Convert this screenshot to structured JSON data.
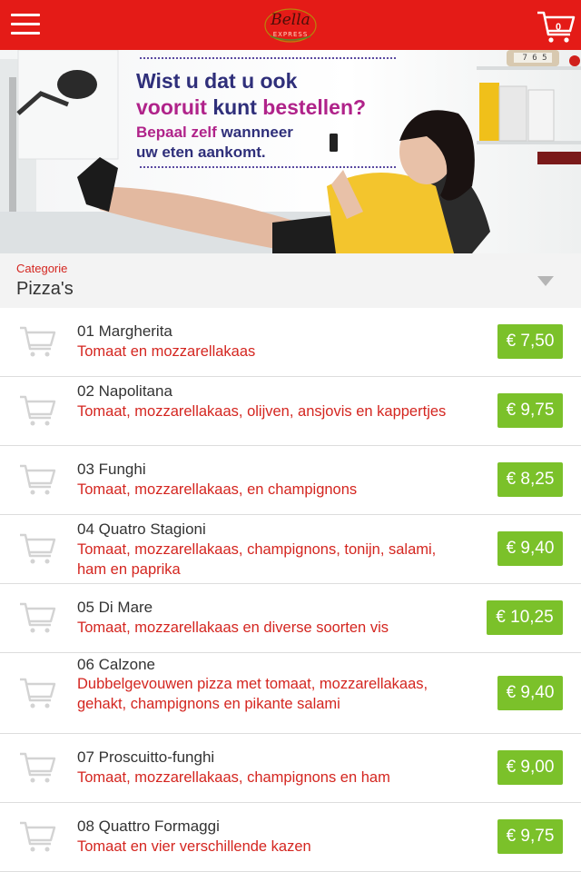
{
  "header": {
    "logo_script": "Bella",
    "logo_sub": "EXPRESS",
    "cart_count": "0"
  },
  "banner": {
    "line1": "Wist u dat u ook",
    "line2_part1": "vooruit",
    "line2_part2": "kunt",
    "line2_part3": "bestellen?",
    "line3_part1": "Bepaal zelf",
    "line3_part2": "wannneer",
    "line4": "uw eten aankomt.",
    "clock_text": "7 6 5"
  },
  "category": {
    "label": "Categorie",
    "value": "Pizza's"
  },
  "products": [
    {
      "name": "01 Margherita",
      "description": "Tomaat en mozzarellakaas",
      "price": "€ 7,50"
    },
    {
      "name": "02 Napolitana",
      "description": "Tomaat, mozzarellakaas, olijven, ansjovis en kappertjes",
      "price": "€ 9,75"
    },
    {
      "name": "03 Funghi",
      "description": "Tomaat, mozzarellakaas, en champignons",
      "price": "€ 8,25"
    },
    {
      "name": "04 Quatro Stagioni",
      "description": "Tomaat, mozzarellakaas, champignons, tonijn, salami, ham en paprika",
      "price": "€ 9,40"
    },
    {
      "name": "05 Di Mare",
      "description": "Tomaat, mozzarellakaas en diverse soorten vis",
      "price": "€ 10,25"
    },
    {
      "name": "06 Calzone",
      "description": "Dubbelgevouwen pizza met tomaat, mozzarellakaas, gehakt, champignons en pikante salami",
      "price": "€ 9,40"
    },
    {
      "name": "07 Proscuitto-funghi",
      "description": "Tomaat, mozzarellakaas, champignons en ham",
      "price": "€ 9,00"
    },
    {
      "name": "08 Quattro Formaggi",
      "description": "Tomaat en vier verschillende kazen",
      "price": "€ 9,75"
    }
  ],
  "colors": {
    "header": "#e41b17",
    "price_badge": "#7bc12a",
    "description_text": "#d42620",
    "category_bg": "#f3f3f3"
  },
  "icons": {
    "menu": "hamburger-icon",
    "cart": "shopping-cart-icon",
    "dropdown": "triangle-down-icon"
  }
}
